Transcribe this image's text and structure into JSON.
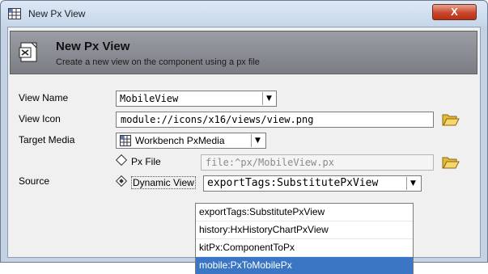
{
  "window": {
    "title": "New Px View",
    "close_label": "X"
  },
  "header": {
    "title": "New Px View",
    "subtitle": "Create a new view on the component using a px file"
  },
  "form": {
    "view_name_label": "View Name",
    "view_name_value": "MobileView",
    "view_icon_label": "View Icon",
    "view_icon_value": "module://icons/x16/views/view.png",
    "target_media_label": "Target Media",
    "target_media_value": "Workbench PxMedia",
    "source_label": "Source",
    "px_file_label": "Px File",
    "px_file_value": "file:^px/MobileView.px",
    "dynamic_view_label": "Dynamic View",
    "dynamic_view_value": "exportTags:SubstitutePxView",
    "dynamic_view_options": [
      "exportTags:SubstitutePxView",
      "history:HxHistoryChartPxView",
      "kitPx:ComponentToPx",
      "mobile:PxToMobilePx"
    ],
    "dynamic_view_highlighted_index": 3
  },
  "icons": {
    "title": "grid-icon",
    "header": "new-view-icon",
    "folder": "folder-open-icon",
    "combo_arrow": "chevron-down-icon"
  },
  "colors": {
    "selection": "#3a76c3",
    "header_band": "#8a8e94",
    "close_button": "#c9462c",
    "title_bar": "#d3e0f0"
  }
}
